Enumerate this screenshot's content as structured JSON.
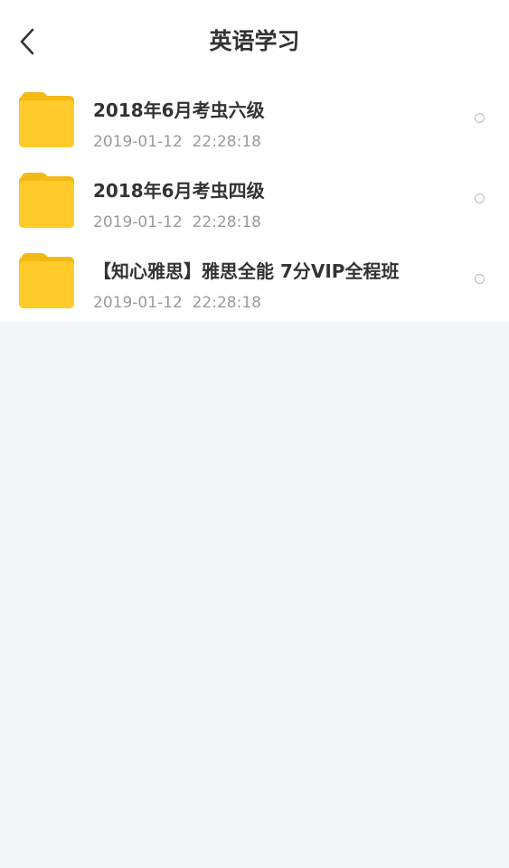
{
  "header": {
    "title": "英语学习"
  },
  "items": [
    {
      "name": "2018年6月考虫六级",
      "date": "2019-01-12  22:28:18"
    },
    {
      "name": "2018年6月考虫四级",
      "date": "2019-01-12  22:28:18"
    },
    {
      "name": "【知心雅思】雅思全能 7分VIP全程班",
      "date": "2019-01-12  22:28:18"
    }
  ],
  "colors": {
    "folder": "#ffcb2b",
    "folder_tab": "#f5b914",
    "page_background": "#f4f5f7"
  }
}
